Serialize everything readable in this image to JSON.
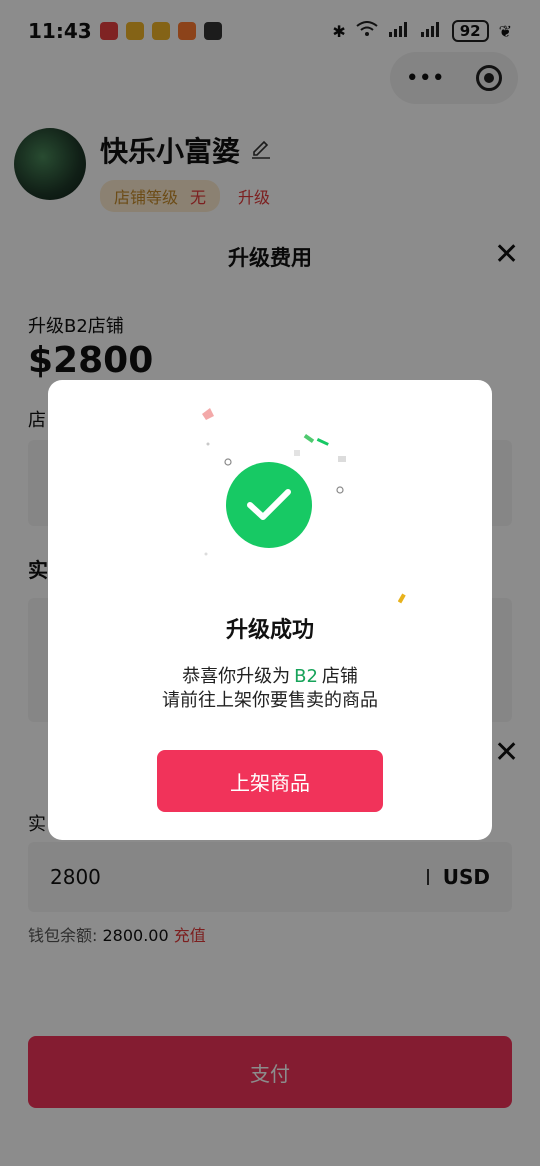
{
  "status_bar": {
    "time": "11:43",
    "battery": "92"
  },
  "capsule": {
    "more": "•••"
  },
  "profile": {
    "name": "快乐小富婆",
    "level_label": "店铺等级",
    "level_value": "无",
    "upgrade_link": "升级"
  },
  "sheet": {
    "title": "升级费用",
    "fee_label": "升级B2店铺",
    "fee_amount": "$2800",
    "section_label_1": "店",
    "section_label_2": "实",
    "section_label_3": "实",
    "amount_value": "2800",
    "currency": "USD",
    "wallet_label": "钱包余额:",
    "wallet_balance": "2800.00",
    "recharge": "充值",
    "pay_button": "支付"
  },
  "modal": {
    "title": "升级成功",
    "msg_prefix": "恭喜你升级为",
    "msg_level": "B2",
    "msg_suffix": "店铺",
    "msg_line2": "请前往上架你要售卖的商品",
    "button": "上架商品"
  },
  "colors": {
    "accent": "#f1335a",
    "success": "#17c964"
  }
}
